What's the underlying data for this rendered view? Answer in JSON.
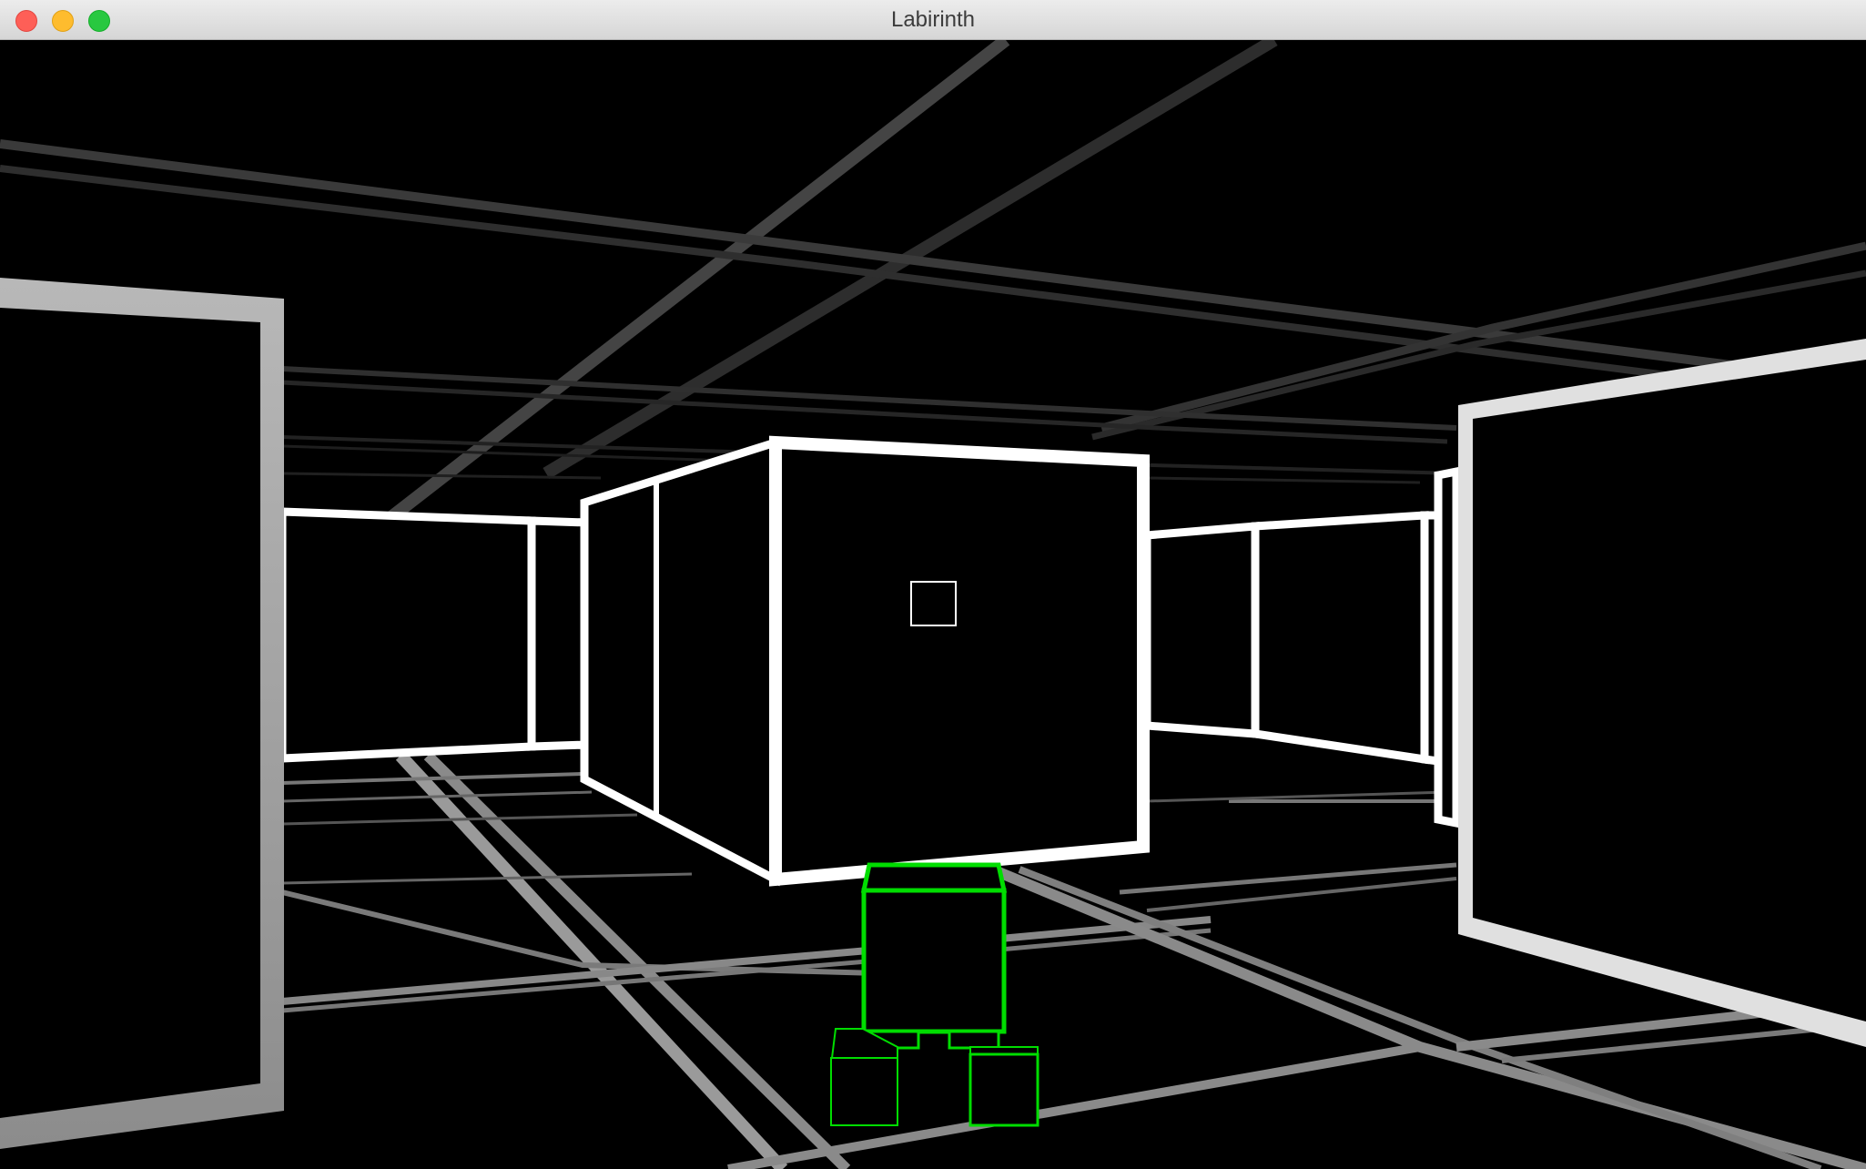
{
  "window": {
    "title": "Labirinth",
    "buttons": [
      "close",
      "minimize",
      "zoom"
    ]
  },
  "scene": {
    "background": "#000000",
    "wall_color": "#ffffff",
    "player_color": "#00dd00",
    "crosshair": "square"
  }
}
